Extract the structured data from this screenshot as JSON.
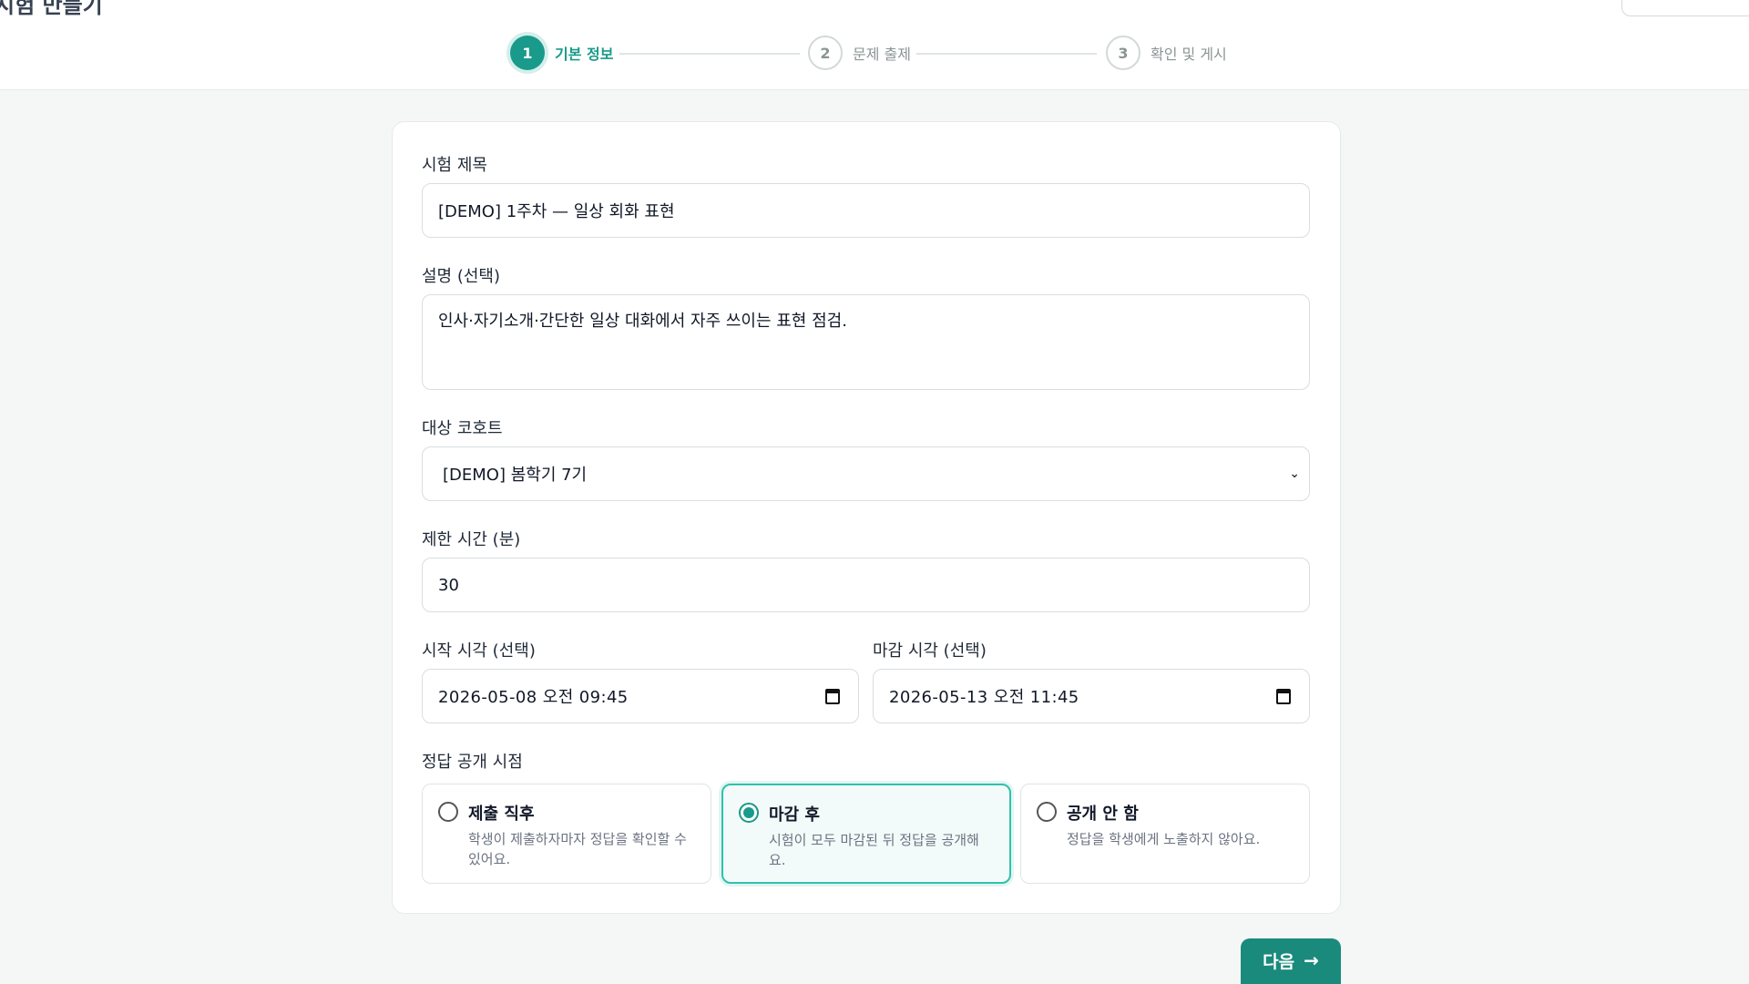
{
  "header": {
    "title": "시험 만들기",
    "steps": [
      {
        "number": "1",
        "label": "기본 정보",
        "state": "active"
      },
      {
        "number": "2",
        "label": "문제 출제",
        "state": "inactive"
      },
      {
        "number": "3",
        "label": "확인 및 게시",
        "state": "inactive"
      }
    ]
  },
  "form": {
    "title_label": "시험 제목",
    "title_value": "[DEMO] 1주차 — 일상 회화 표현",
    "desc_label": "설명 (선택)",
    "desc_value": "인사·자기소개·간단한 일상 대화에서 자주 쓰이는 표현 점검.",
    "cohort_label": "대상 코호트",
    "cohort_value": "[DEMO] 봄학기 7기",
    "time_label": "제한 시간 (분)",
    "time_value": "30",
    "start_label": "시작 시각 (선택)",
    "start_value": "2026-05-08 오전 09:45",
    "end_label": "마감 시각 (선택)",
    "end_value": "2026-05-13 오전 11:45",
    "reveal_label": "정답 공개 시점",
    "reveal_options": [
      {
        "title": "제출 직후",
        "desc": "학생이 제출하자마자 정답을 확인할 수 있어요.",
        "selected": false
      },
      {
        "title": "마감 후",
        "desc": "시험이 모두 마감된 뒤 정답을 공개해요.",
        "selected": true
      },
      {
        "title": "공개 안 함",
        "desc": "정답을 학생에게 노출하지 않아요.",
        "selected": false
      }
    ]
  },
  "footer": {
    "next_label": "다음",
    "next_icon": "arrow-right-icon"
  },
  "colors": {
    "accent": "#1a9a8a",
    "button": "#1a8a7c",
    "selected_border": "#2fc1ad"
  }
}
